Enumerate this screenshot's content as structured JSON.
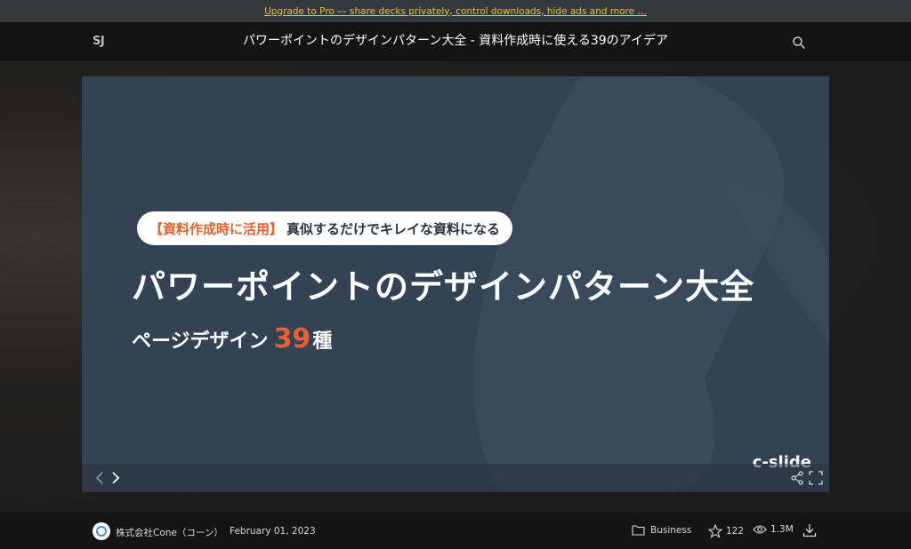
{
  "promo": {
    "text": "Upgrade to Pro — share decks privately, control downloads, hide ads and more …"
  },
  "header": {
    "logo": "SJ",
    "title": "パワーポイントのデザインパターン大全 - 資料作成時に使える39のアイデア",
    "search_icon": "search-icon"
  },
  "slide": {
    "pill_accent": "【資料作成時に活用】",
    "pill_text": "真似するだけでキレイな資料になる",
    "main_title": "パワーポイントのデザインパターン大全",
    "subtitle_pre": "ページデザイン",
    "subtitle_num": "39",
    "subtitle_post": "種",
    "brand": "c-slide",
    "colors": {
      "background": "#334354",
      "accent": "#e8602f",
      "text": "#ffffff"
    }
  },
  "controls": {
    "icons": [
      "prev-icon",
      "next-icon",
      "share-icon",
      "fullscreen-icon"
    ]
  },
  "footer": {
    "author": "株式会社Cone（コーン）",
    "date": "February 01, 2023",
    "category": "Business",
    "stars": "122",
    "views": "1.3M",
    "icons": [
      "folder-icon",
      "star-icon",
      "eye-icon",
      "download-icon"
    ]
  },
  "colors": {
    "promo_bg": "#33393d",
    "promo_link": "#f1c40f",
    "bar_bg": "#141414",
    "page_bg": "#1e1e1e"
  }
}
